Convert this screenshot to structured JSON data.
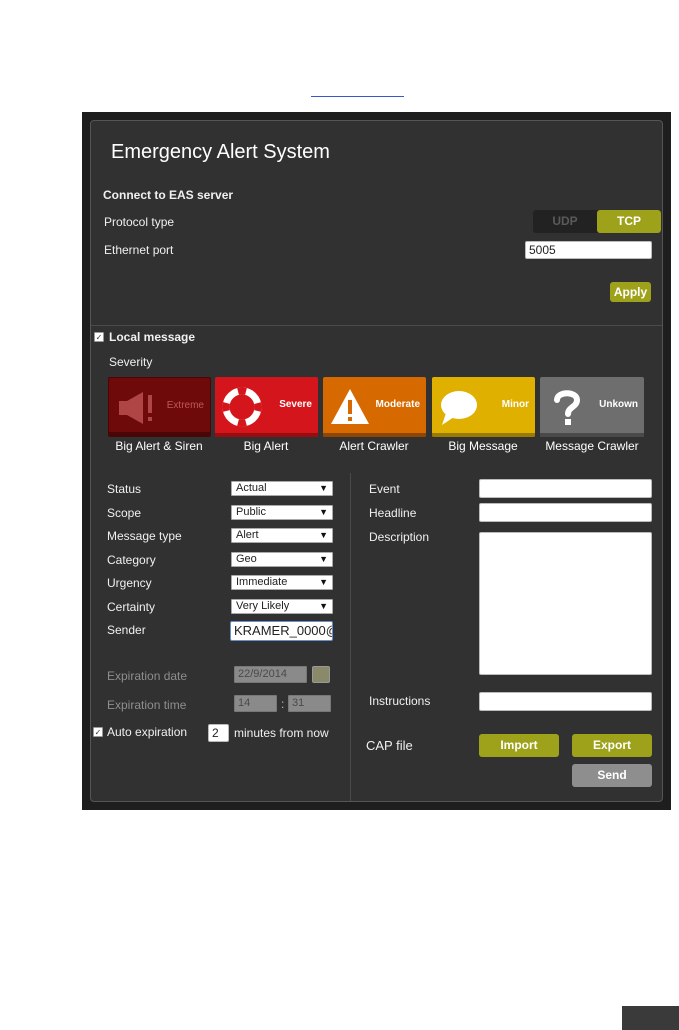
{
  "app": {
    "title": "Emergency Alert System"
  },
  "connect": {
    "section_title": "Connect to EAS server",
    "protocol_label": "Protocol type",
    "protocol_options": [
      "UDP",
      "TCP"
    ],
    "protocol_selected": "TCP",
    "port_label": "Ethernet port",
    "port_value": "5005",
    "apply_label": "Apply"
  },
  "local_message": {
    "label": "Local message",
    "checked": true,
    "severity_label": "Severity",
    "severities": [
      {
        "badge": "Extreme",
        "name": "Big Alert & Siren",
        "color": "#6e0a0a",
        "icon": "megaphone-icon"
      },
      {
        "badge": "Severe",
        "name": "Big Alert",
        "color": "#d4161c",
        "icon": "lifebuoy-icon"
      },
      {
        "badge": "Moderate",
        "name": "Alert Crawler",
        "color": "#d66a00",
        "icon": "warning-icon"
      },
      {
        "badge": "Minor",
        "name": "Big Message",
        "color": "#e0b000",
        "icon": "speech-bubble-icon"
      },
      {
        "badge": "Unkown",
        "name": "Message Crawler",
        "color": "#6e6e6e",
        "icon": "question-icon"
      }
    ]
  },
  "form": {
    "status": {
      "label": "Status",
      "value": "Actual"
    },
    "scope": {
      "label": "Scope",
      "value": "Public"
    },
    "message_type": {
      "label": "Message type",
      "value": "Alert"
    },
    "category": {
      "label": "Category",
      "value": "Geo"
    },
    "urgency": {
      "label": "Urgency",
      "value": "Immediate"
    },
    "certainty": {
      "label": "Certainty",
      "value": "Very Likely"
    },
    "sender": {
      "label": "Sender",
      "value": "KRAMER_0000@"
    },
    "expiration_date": {
      "label": "Expiration date",
      "value": "22/9/2014"
    },
    "expiration_time": {
      "label": "Expiration time",
      "hour": "14",
      "separator": ":",
      "minute": "31"
    },
    "auto_expiration": {
      "label": "Auto expiration",
      "checked": true,
      "value": "2",
      "suffix": "minutes from now"
    }
  },
  "right": {
    "event_label": "Event",
    "headline_label": "Headline",
    "description_label": "Description",
    "instructions_label": "Instructions",
    "cap_label": "CAP file",
    "import_label": "Import",
    "export_label": "Export",
    "send_label": "Send"
  },
  "colors": {
    "accent": "#9ea21b",
    "panel": "#313131"
  }
}
